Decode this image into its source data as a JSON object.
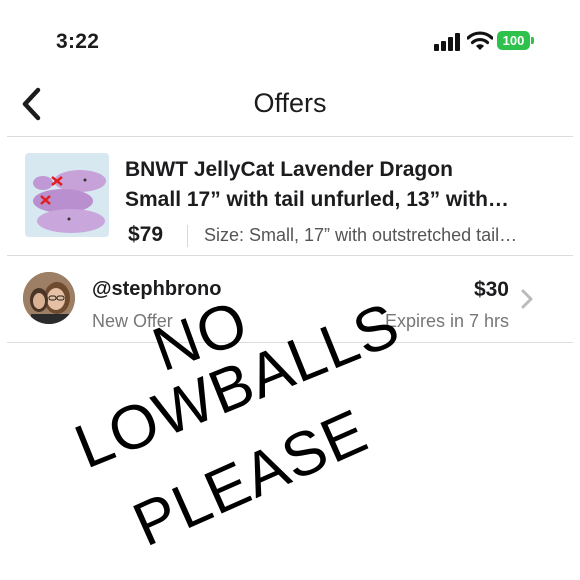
{
  "status_bar": {
    "time": "3:22",
    "battery": "100",
    "icons": [
      "signal-icon",
      "wifi-icon",
      "battery-icon"
    ]
  },
  "nav": {
    "title": "Offers",
    "back_icon": "chevron-left-icon"
  },
  "listing": {
    "title_line1": "BNWT JellyCat Lavender Dragon",
    "title_line2": "Small 17” with tail unfurled, 13” with…",
    "price": "$79",
    "size": "Size: Small, 17” with outstretched tail…"
  },
  "offer": {
    "username": "@stephbrono",
    "status": "New Offer",
    "amount": "$30",
    "expires": "Expires in 7 hrs",
    "chevron_icon": "chevron-right-icon"
  },
  "overlay_text": {
    "line1": "NO",
    "line2": "LOWBALLS",
    "line3": "PLEASE"
  },
  "colors": {
    "battery_green": "#2ec24d",
    "divider": "#dcdcdc",
    "secondary_text": "#777777"
  }
}
